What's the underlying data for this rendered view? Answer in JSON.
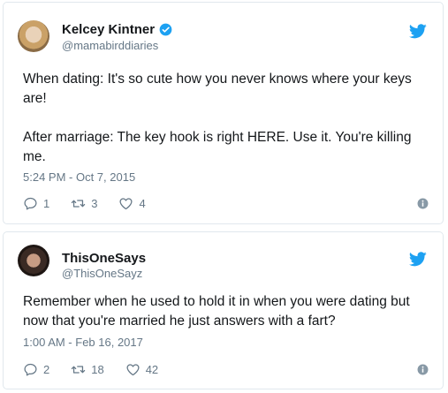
{
  "tweets": [
    {
      "display_name": "Kelcey Kintner",
      "handle": "@mamabirddiaries",
      "verified": true,
      "text_p1": "When dating: It's so cute how you never knows where your keys are!",
      "text_p2": "After marriage: The key hook is right HERE. Use it. You're killing me.",
      "timestamp": "5:24 PM - Oct 7, 2015",
      "reply_count": "1",
      "retweet_count": "3",
      "like_count": "4"
    },
    {
      "display_name": "ThisOneSays",
      "handle": "@ThisOneSayz",
      "verified": false,
      "text": "Remember when he used to hold it in when you were dating but now that you're married he just answers with a fart?",
      "timestamp": "1:00 AM - Feb 16, 2017",
      "reply_count": "2",
      "retweet_count": "18",
      "like_count": "42"
    }
  ],
  "colors": {
    "twitter_blue": "#1da1f2",
    "text": "#14171a",
    "muted": "#657786",
    "border": "#e1e8ed"
  },
  "icons": [
    "twitter-bird-icon",
    "verified-badge-icon",
    "reply-icon",
    "retweet-icon",
    "like-icon",
    "info-icon"
  ]
}
